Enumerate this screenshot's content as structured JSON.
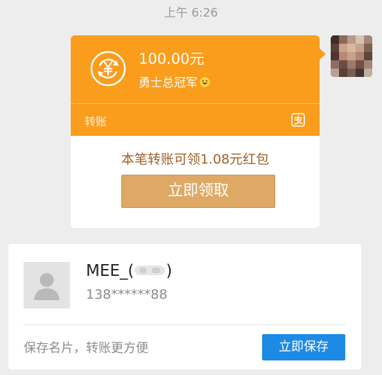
{
  "timestamp": "上午 6:26",
  "transfer": {
    "amount": "100.00元",
    "remark": "勇士总冠军",
    "type_label": "转账",
    "redpacket_text": "本笔转账可领1.08元红包",
    "claim_button": "立即领取",
    "icons": {
      "transfer": "yuan-exchange-icon",
      "emoji": "grin-emoji-icon",
      "alipay": "alipay-icon"
    }
  },
  "contact_card": {
    "name": "MEE_(",
    "name_suffix": ")",
    "phone": "138******88",
    "save_tip": "保存名片，转账更方便",
    "save_button": "立即保存",
    "avatar_icon": "default-person-icon"
  },
  "colors": {
    "transfer_orange": "#fa9d1c",
    "claim_gold": "#dea965",
    "save_blue": "#1d8ae6",
    "background": "#ededed"
  }
}
